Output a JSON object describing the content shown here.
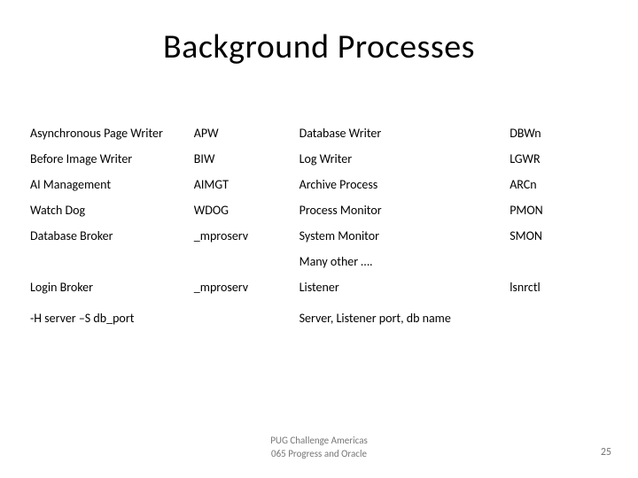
{
  "title": "Background Processes",
  "rows": [
    {
      "c1": "Asynchronous Page Writer",
      "c2": "APW",
      "c3": "Database Writer",
      "c4": "DBWn"
    },
    {
      "c1": "Before Image Writer",
      "c2": "BIW",
      "c3": "Log Writer",
      "c4": "LGWR"
    },
    {
      "c1": "AI Management",
      "c2": "AIMGT",
      "c3": "Archive Process",
      "c4": "ARCn"
    },
    {
      "c1": "Watch Dog",
      "c2": "WDOG",
      "c3": "Process Monitor",
      "c4": "PMON"
    },
    {
      "c1": "Database Broker",
      "c2": "_mproserv",
      "c3": "System Monitor",
      "c4": "SMON"
    },
    {
      "c1": "",
      "c2": "",
      "c3": "Many other ….",
      "c4": ""
    },
    {
      "c1": "Login Broker",
      "c2": "_mproserv",
      "c3": "Listener",
      "c4": "lsnrctl"
    }
  ],
  "bottom": {
    "left": "-H server –S db_port",
    "right": "Server, Listener port, db name"
  },
  "footer": {
    "line1": "PUG Challenge Americas",
    "line2": "065 Progress and Oracle"
  },
  "page_number": "25"
}
